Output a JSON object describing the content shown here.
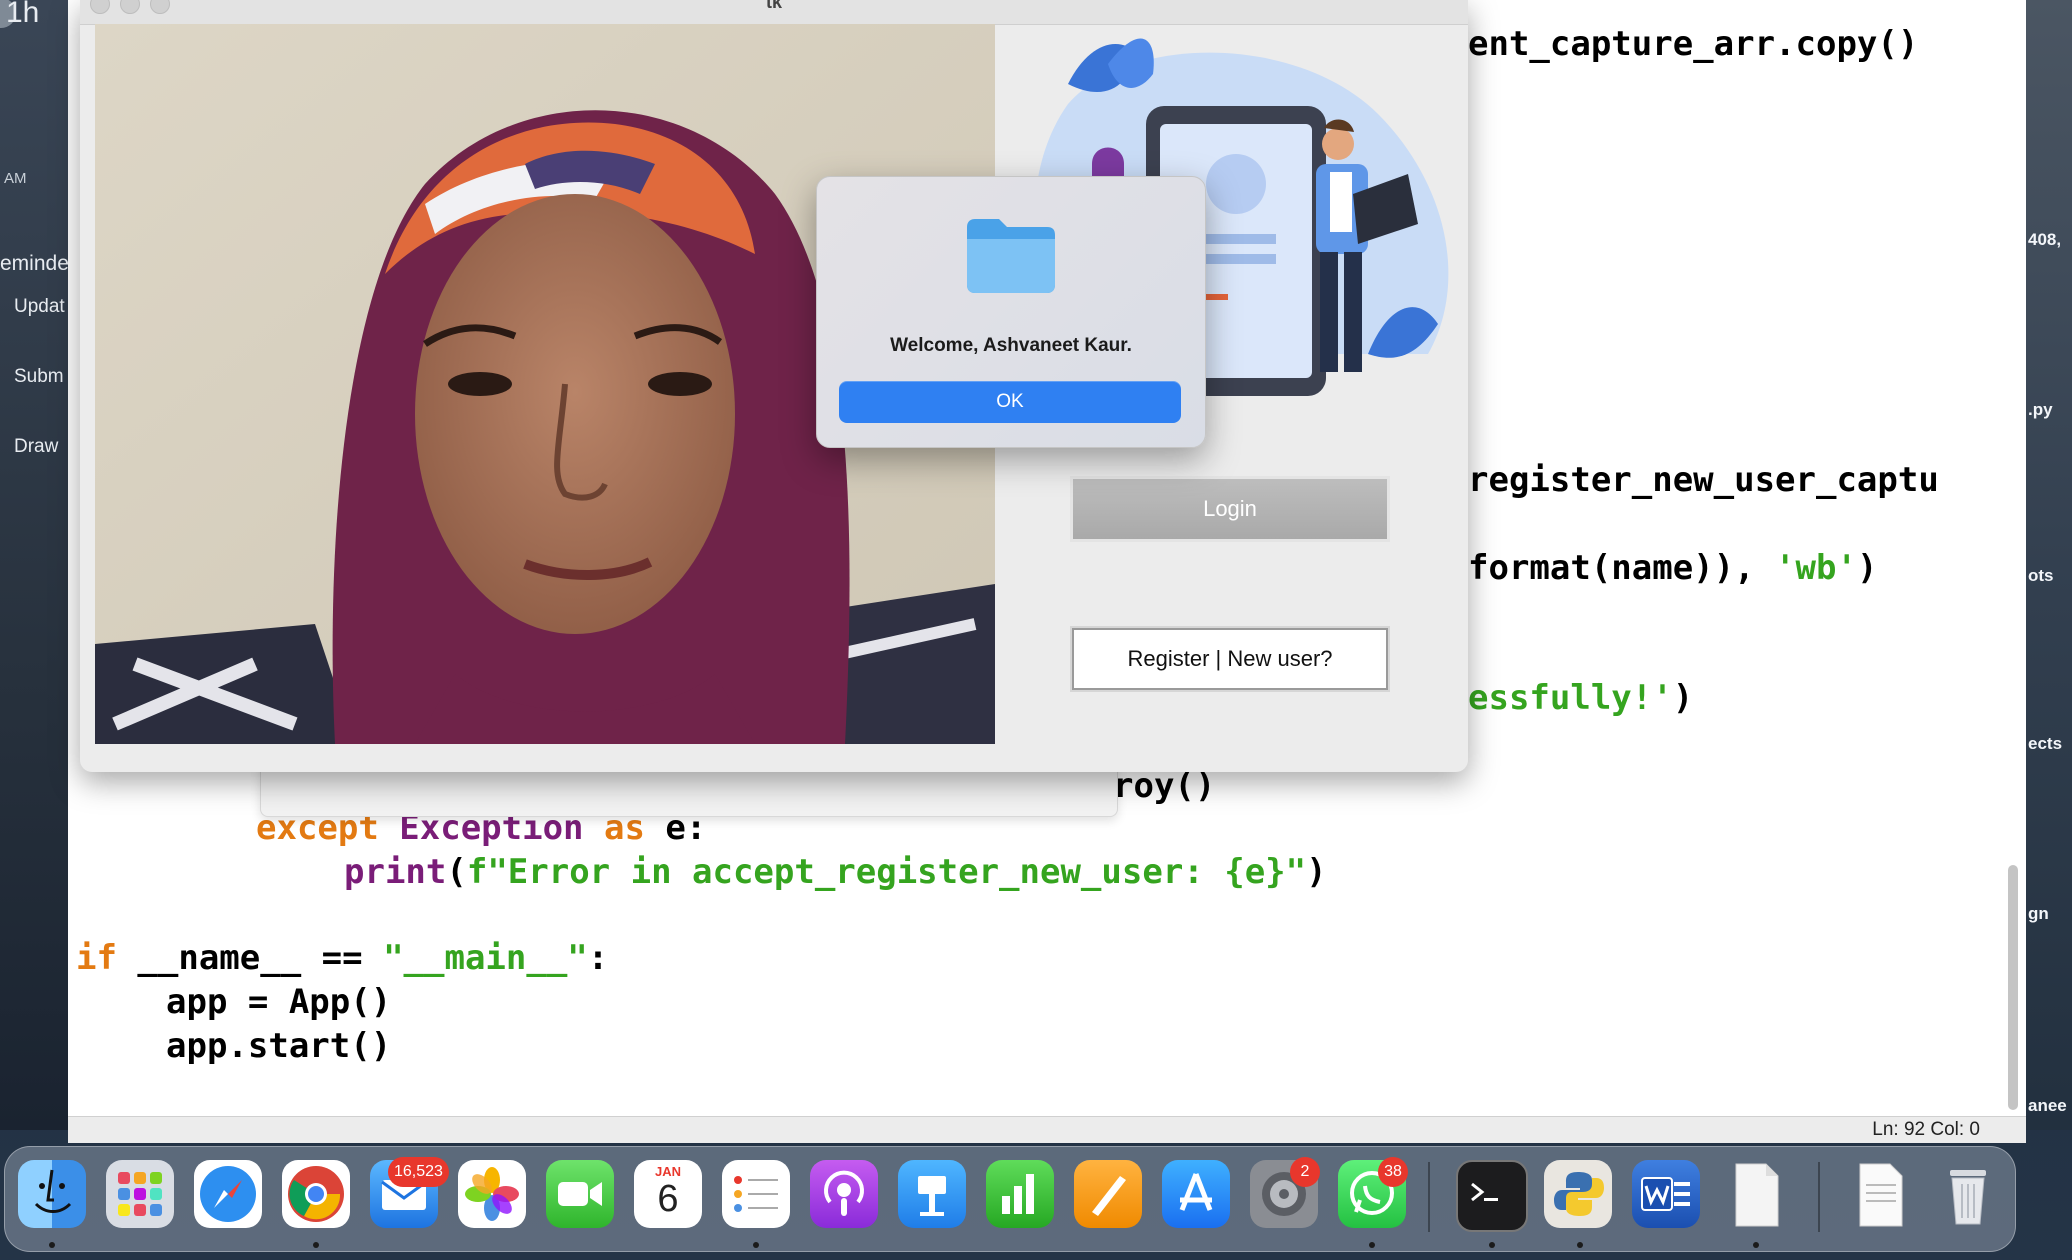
{
  "desktop": {
    "left_strip": {
      "top_text": "1h",
      "time_text": "AM",
      "heading": "eminde",
      "items": [
        "Updat",
        "Subm",
        "Draw"
      ]
    },
    "right_strip": {
      "items": [
        "408,",
        ".py",
        "ots",
        "ects",
        "gn",
        "anee"
      ]
    }
  },
  "editor": {
    "lines": {
      "l1": "ent_capture_arr.copy()",
      "l2": "register_new_user_captu",
      "l3a": "format(name)), ",
      "l3b": "'wb'",
      "l3c": ")",
      "l4a": "essfully!'",
      "l4b": ")",
      "l5": "roy()",
      "l6a": "except ",
      "l6b": "Exception ",
      "l6c": "as ",
      "l6d": "e:",
      "l7a": "print",
      "l7b": "(",
      "l7c": "f\"Error in accept_register_new_user: {e}\"",
      "l7d": ")",
      "l8a": "if ",
      "l8b": "__name__ == ",
      "l8c": "\"__main__\"",
      "l8d": ":",
      "l9": "app = App()",
      "l10": "app.start()"
    },
    "status": "Ln: 92  Col: 0"
  },
  "tk_window": {
    "title": "tk",
    "login_label": "Login",
    "register_label": "Register | New user?"
  },
  "alert": {
    "icon": "folder-icon",
    "message": "Welcome, Ashvaneet Kaur.",
    "ok_label": "OK"
  },
  "dock": {
    "apps": [
      "Finder",
      "Launchpad",
      "Safari",
      "Chrome",
      "Mail",
      "Photos",
      "FaceTime",
      "Calendar",
      "Reminders",
      "Podcasts",
      "Keynote",
      "Numbers",
      "Pages",
      "App Store",
      "System Preferences",
      "WhatsApp",
      "Terminal",
      "Python Launcher",
      "Word",
      "Document",
      "Document",
      "Trash"
    ],
    "mail_badge": "16,523",
    "settings_badge": "2",
    "whatsapp_badge": "38",
    "calendar_month": "JAN",
    "calendar_day": "6"
  },
  "colors": {
    "keyword": "#e37a12",
    "class": "#7a1d78",
    "string": "#35a41f",
    "ok_button": "#2f80f2"
  }
}
